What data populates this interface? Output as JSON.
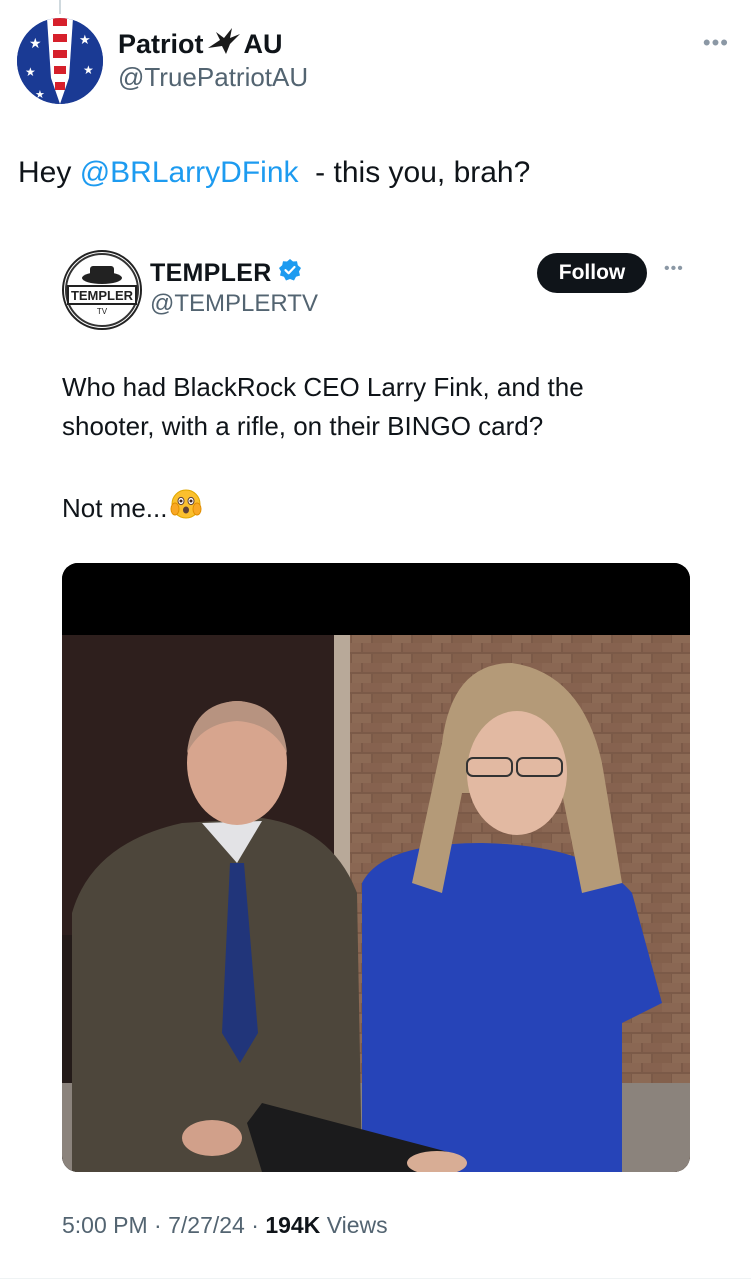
{
  "author": {
    "name_part1": "Patriot",
    "name_part2": "AU",
    "handle": "@TruePatriotAU"
  },
  "tweet": {
    "prefix": "Hey ",
    "mention": "@BRLarryDFink",
    "suffix": "  - this you, brah?"
  },
  "quoted": {
    "name": "TEMPLER",
    "handle": "@TEMPLERTV",
    "avatar_text": "TEMPLER",
    "avatar_subtext": "TV",
    "follow_label": "Follow",
    "text_line1": "Who had BlackRock CEO Larry Fink, and the",
    "text_line2": "shooter, with a rifle, on their BINGO card?",
    "text_line3": "Not me...",
    "media_label": ""
  },
  "meta": {
    "time": "5:00 PM",
    "date": "7/27/24",
    "views_count": "194K",
    "views_label": "Views",
    "sep": "·"
  },
  "colors": {
    "link": "#1d9bf0",
    "text": "#0f1419",
    "secondary": "#536471",
    "verified": "#1d9bf0"
  },
  "icons": [
    "eagle-icon",
    "verified-badge-icon",
    "more-options-icon",
    "flushed-face-emoji"
  ]
}
